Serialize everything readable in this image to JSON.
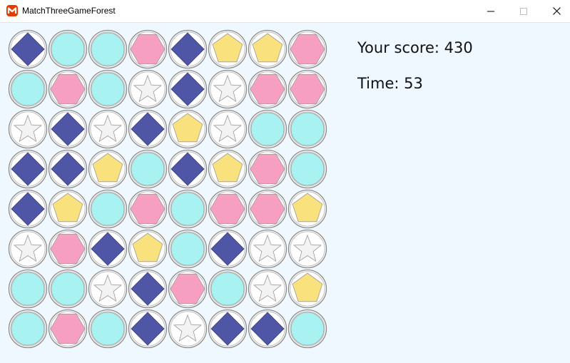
{
  "window": {
    "title": "MatchThreeGameForest",
    "icon": "monogame-logo-icon",
    "controls": [
      "minimize-icon",
      "maximize-icon",
      "close-icon"
    ]
  },
  "hud": {
    "score_text": "Your score: 430",
    "time_text": "Time: 53"
  },
  "board": {
    "rows": 8,
    "cols": 8,
    "grid": [
      [
        "diamond",
        "circle",
        "circle",
        "hexagon",
        "diamond",
        "pentagon",
        "pentagon",
        "hexagon"
      ],
      [
        "circle",
        "hexagon",
        "circle",
        "star",
        "diamond",
        "star",
        "hexagon",
        "hexagon"
      ],
      [
        "star",
        "diamond",
        "star",
        "diamond",
        "pentagon",
        "star",
        "circle",
        "circle"
      ],
      [
        "diamond",
        "diamond",
        "pentagon",
        "circle",
        "diamond",
        "pentagon",
        "hexagon",
        "circle"
      ],
      [
        "diamond",
        "pentagon",
        "circle",
        "hexagon",
        "circle",
        "hexagon",
        "hexagon",
        "pentagon"
      ],
      [
        "star",
        "hexagon",
        "diamond",
        "pentagon",
        "circle",
        "diamond",
        "star",
        "star"
      ],
      [
        "circle",
        "circle",
        "star",
        "diamond",
        "hexagon",
        "circle",
        "star",
        "pentagon"
      ],
      [
        "circle",
        "hexagon",
        "circle",
        "diamond",
        "star",
        "diamond",
        "diamond",
        "circle"
      ]
    ]
  },
  "colors": {
    "background": "#f0f8ff",
    "diamond": "#4f56a5",
    "circle": "#a8f3f2",
    "hexagon": "#f79fc1",
    "pentagon": "#f9e27e",
    "star": "#f3f3f3",
    "ring": "#8a8a8a"
  }
}
